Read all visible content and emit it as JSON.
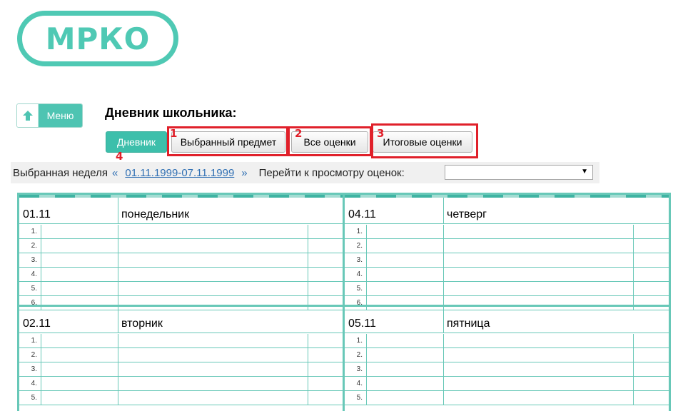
{
  "logo": {
    "text": "МРКО"
  },
  "menu_button": {
    "label": "Меню"
  },
  "page_title": "Дневник школьника:",
  "tabs": [
    {
      "label": "Дневник",
      "active": true
    },
    {
      "label": "Выбранный предмет",
      "active": false
    },
    {
      "label": "Все оценки",
      "active": false
    },
    {
      "label": "Итоговые оценки",
      "active": false
    }
  ],
  "annotations": [
    "1",
    "2",
    "3",
    "4"
  ],
  "week": {
    "label": "Выбранная неделя",
    "prev": "«",
    "range": "01.11.1999-07.11.1999",
    "next": "»",
    "goto_label": "Перейти к просмотру оценок:",
    "select_value": ""
  },
  "days": [
    {
      "date": "01.11",
      "name": "понедельник",
      "lessons": [
        "1.",
        "2.",
        "3.",
        "4.",
        "5.",
        "6."
      ]
    },
    {
      "date": "04.11",
      "name": "четверг",
      "lessons": [
        "1.",
        "2.",
        "3.",
        "4.",
        "5.",
        "6."
      ]
    },
    {
      "date": "02.11",
      "name": "вторник",
      "lessons": [
        "1.",
        "2.",
        "3.",
        "4.",
        "5."
      ]
    },
    {
      "date": "05.11",
      "name": "пятница",
      "lessons": [
        "1.",
        "2.",
        "3.",
        "4.",
        "5."
      ]
    }
  ],
  "colors": {
    "accent": "#4ec4b2",
    "grid": "#68c8b8",
    "annotation": "#e0202a",
    "link": "#2f6fb3"
  }
}
